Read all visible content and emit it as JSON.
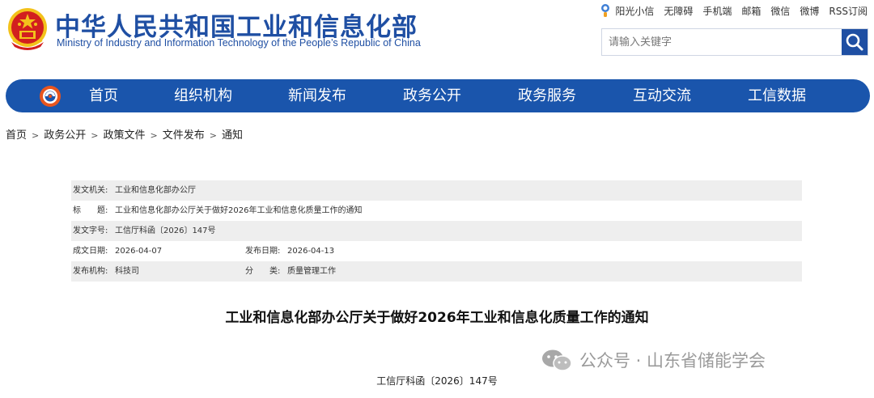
{
  "header": {
    "title": "中华人民共和国工业和信息化部",
    "subtitle": "Ministry of Industry and Information Technology of the People’s Republic of China",
    "emblem_icon": "national-emblem-icon"
  },
  "top_links": [
    "阳光小信",
    "无障碍",
    "手机端",
    "邮箱",
    "微信",
    "微博",
    "RSS订阅"
  ],
  "search": {
    "placeholder": "请输入关键字",
    "icon": "search-icon"
  },
  "nav": {
    "logo_icon": "ministry-logo-icon",
    "items": [
      "首页",
      "组织机构",
      "新闻发布",
      "政务公开",
      "政务服务",
      "互动交流",
      "工信数据"
    ]
  },
  "breadcrumb": [
    "首页",
    "政务公开",
    "政策文件",
    "文件发布",
    "通知"
  ],
  "meta": {
    "issuer_label": "发文机关:",
    "issuer_value": "工业和信息化部办公厅",
    "title_label": "标　　题:",
    "title_value": "工业和信息化部办公厅关于做好2026年工业和信息化质量工作的通知",
    "docno_label": "发文字号:",
    "docno_value": "工信厅科函〔2026〕147号",
    "written_label": "成文日期:",
    "written_value": "2026-04-07",
    "published_label": "发布日期:",
    "published_value": "2026-04-13",
    "org_label": "发布机构:",
    "org_value": "科技司",
    "category_label": "分　　类:",
    "category_value": "质量管理工作"
  },
  "article": {
    "title": "工业和信息化部办公厅关于做好2026年工业和信息化质量工作的通知",
    "doc_number": "工信厅科函〔2026〕147号"
  },
  "watermark": {
    "text": "公众号 · 山东省储能学会",
    "icon": "wechat-icon"
  },
  "colors": {
    "brand_blue": "#1a55ac",
    "title_blue": "#1f4fa3",
    "emblem_red": "#d21f1f",
    "emblem_gold": "#f3c21b"
  }
}
